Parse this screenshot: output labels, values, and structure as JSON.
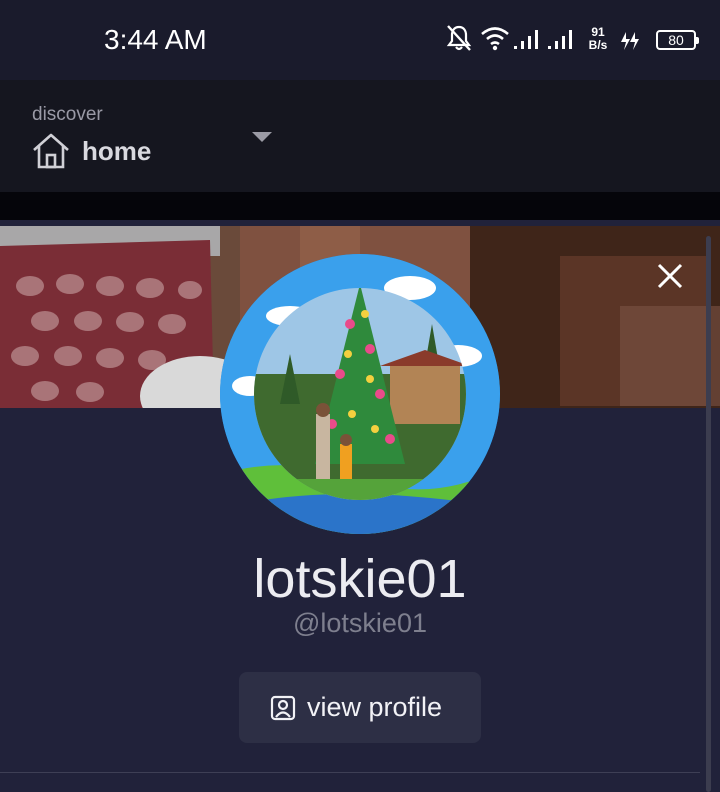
{
  "status_bar": {
    "time": "3:44 AM",
    "net_speed_value": "91",
    "net_speed_unit": "B/s",
    "battery": "80",
    "icons": [
      "bell-off-icon",
      "wifi-icon",
      "signal-icon",
      "signal-icon",
      "charging-icon",
      "battery-icon"
    ]
  },
  "header": {
    "subtitle": "discover",
    "title": "home",
    "icon": "home-icon"
  },
  "profile": {
    "username": "lotskie01",
    "handle": "@lotskie01",
    "view_profile_label": "view profile"
  },
  "colors": {
    "background": "#21223a",
    "header": "#15161f",
    "status_bar": "#1a1b2c",
    "button": "#2d2f45",
    "avatar_ring": "#2a8fe0"
  }
}
